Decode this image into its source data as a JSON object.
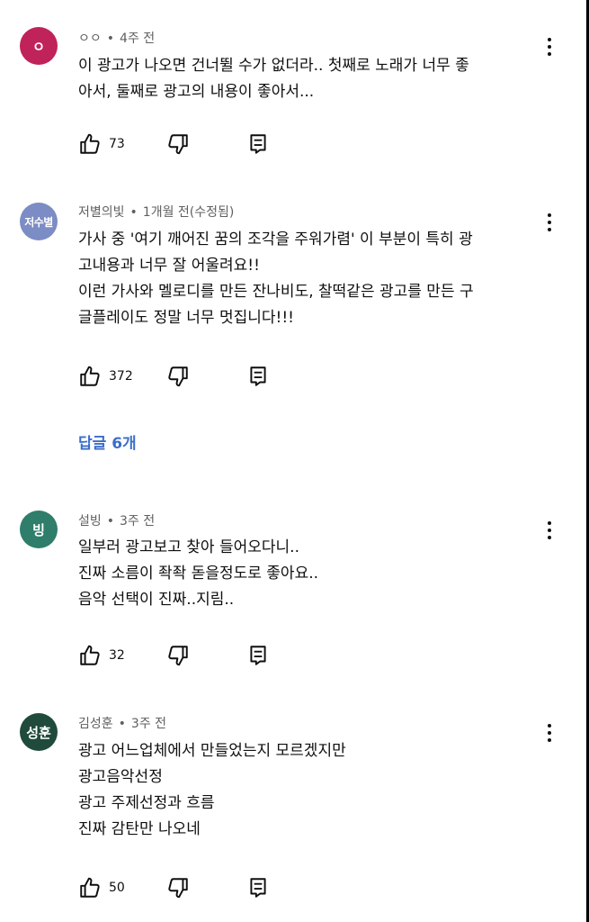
{
  "comments": [
    {
      "avatar_text": "ㅇ",
      "avatar_color": "#c0225a",
      "author": "ㅇㅇ",
      "time": "4주 전",
      "lines": [
        "이 광고가 나오면 건너뛸 수가 없더라.. 첫째로 노래가 너무 좋",
        "아서, 둘째로 광고의 내용이 좋아서..."
      ],
      "likes": "73"
    },
    {
      "avatar_text": "저수별",
      "avatar_color": "#7c8cc4",
      "author": "저별의빛",
      "time": "1개월 전(수정됨)",
      "lines": [
        "가사 중 '여기 깨어진 꿈의 조각을 주워가렴' 이 부분이 특히 광",
        "고내용과 너무 잘 어울려요!!",
        "이런 가사와 멜로디를 만든 잔나비도, 찰떡같은 광고를 만든 구",
        "글플레이도 정말 너무 멋집니다!!!"
      ],
      "likes": "372",
      "replies_label": "답글 6개"
    },
    {
      "avatar_text": "빙",
      "avatar_color": "#2f7d6b",
      "author": "설빙",
      "time": "3주 전",
      "lines": [
        "일부러 광고보고 찾아 들어오다니..",
        "진짜 소름이 좍좍 돋을정도로 좋아요..",
        "음악 선택이 진짜..지림.."
      ],
      "likes": "32"
    },
    {
      "avatar_text": "성훈",
      "avatar_color": "#1f4a3c",
      "author": "김성훈",
      "time": "3주 전",
      "lines": [
        "광고 어느업체에서 만들었는지 모르겠지만",
        "광고음악선정",
        "광고 주제선정과 흐름",
        "진짜 감탄만 나오네"
      ],
      "likes": "50"
    }
  ],
  "separator": "•",
  "icons": {
    "like": "thumb-up-icon",
    "dislike": "thumb-down-icon",
    "reply": "reply-comment-icon",
    "more": "more-vert-icon"
  }
}
